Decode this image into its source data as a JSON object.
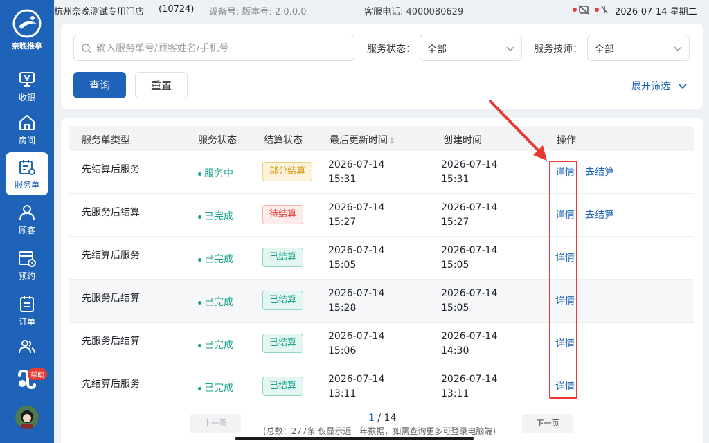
{
  "brand": {
    "name": "奈晚推拿"
  },
  "status_bar": {
    "store_name": "杭州奈晚测试专用门店",
    "store_id": "(10724)",
    "device_info": "设备号: 版本号: 2.0.0.0",
    "hotline": "客服电话: 4000080629",
    "datetime": "2026-07-14 星期二"
  },
  "nav": {
    "items": [
      {
        "label": "收银",
        "icon": "cashier-icon"
      },
      {
        "label": "房间",
        "icon": "house-icon"
      },
      {
        "label": "服务单",
        "icon": "service-order-icon",
        "active": true
      },
      {
        "label": "顾客",
        "icon": "user-icon"
      },
      {
        "label": "预约",
        "icon": "calendar-icon"
      },
      {
        "label": "订单",
        "icon": "order-icon"
      },
      {
        "label": "",
        "icon": "staff-icon"
      }
    ],
    "help_badge": "帮助"
  },
  "filters": {
    "search_placeholder": "输入服务单号/顾客姓名/手机号",
    "status_label": "服务状态：",
    "status_value": "全部",
    "tech_label": "服务技师：",
    "tech_value": "全部",
    "query_button": "查询",
    "reset_button": "重置",
    "expand_label": "展开筛选"
  },
  "table": {
    "columns": [
      "服务单类型",
      "服务状态",
      "结算状态",
      "最后更新时间",
      "创建时间",
      "操作"
    ],
    "rows": [
      {
        "type": "先结算后服务",
        "status": "服务中",
        "settle": "部分结算",
        "settle_kind": "partial",
        "update_date": "2026-07-14",
        "update_time": "15:31",
        "create_date": "2026-07-14",
        "create_time": "15:31",
        "detail": "详情",
        "action2": "去结算"
      },
      {
        "type": "先服务后结算",
        "status": "已完成",
        "settle": "待结算",
        "settle_kind": "pending",
        "update_date": "2026-07-14",
        "update_time": "15:27",
        "create_date": "2026-07-14",
        "create_time": "15:27",
        "detail": "详情",
        "action2": "去结算"
      },
      {
        "type": "先结算后服务",
        "status": "已完成",
        "settle": "已结算",
        "settle_kind": "done",
        "update_date": "2026-07-14",
        "update_time": "15:05",
        "create_date": "2026-07-14",
        "create_time": "15:05",
        "detail": "详情",
        "action2": ""
      },
      {
        "type": "先服务后结算",
        "status": "已完成",
        "settle": "已结算",
        "settle_kind": "done",
        "update_date": "2026-07-14",
        "update_time": "15:28",
        "create_date": "2026-07-14",
        "create_time": "15:05",
        "detail": "详情",
        "action2": ""
      },
      {
        "type": "先服务后结算",
        "status": "已完成",
        "settle": "已结算",
        "settle_kind": "done",
        "update_date": "2026-07-14",
        "update_time": "15:06",
        "create_date": "2026-07-14",
        "create_time": "14:30",
        "detail": "详情",
        "action2": ""
      },
      {
        "type": "先结算后服务",
        "status": "已完成",
        "settle": "已结算",
        "settle_kind": "done",
        "update_date": "2026-07-14",
        "update_time": "13:11",
        "create_date": "2026-07-14",
        "create_time": "13:11",
        "detail": "详情",
        "action2": ""
      }
    ]
  },
  "pagination": {
    "prev": "上一页",
    "next": "下一页",
    "current": "1",
    "total": "/ 14",
    "note": "(总数：277条 仅显示近一年数据，如需查询更多可登录电脑端)"
  },
  "colors": {
    "brand": "#1e63b7",
    "highlight": "#e83a35",
    "success": "#14a38b",
    "warning": "#d99a1a"
  }
}
